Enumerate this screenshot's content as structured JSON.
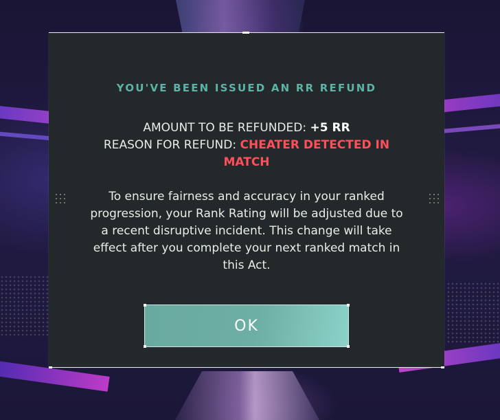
{
  "dialog": {
    "title": "YOU'VE BEEN ISSUED AN RR REFUND",
    "amount_label": "AMOUNT TO BE REFUNDED:",
    "amount_value": "+5 RR",
    "reason_label": "REASON FOR REFUND:",
    "reason_value": "CHEATER DETECTED IN MATCH",
    "body": "To ensure fairness and accuracy in your ranked progression, your Rank Rating will be adjusted due to a recent disruptive incident. This change will take effect after you complete your next ranked match in this Act.",
    "ok_label": "OK"
  },
  "colors": {
    "accent": "#5fb3a6",
    "danger": "#ff4f5a",
    "panel": "#23282a",
    "button": "#6daea5"
  }
}
